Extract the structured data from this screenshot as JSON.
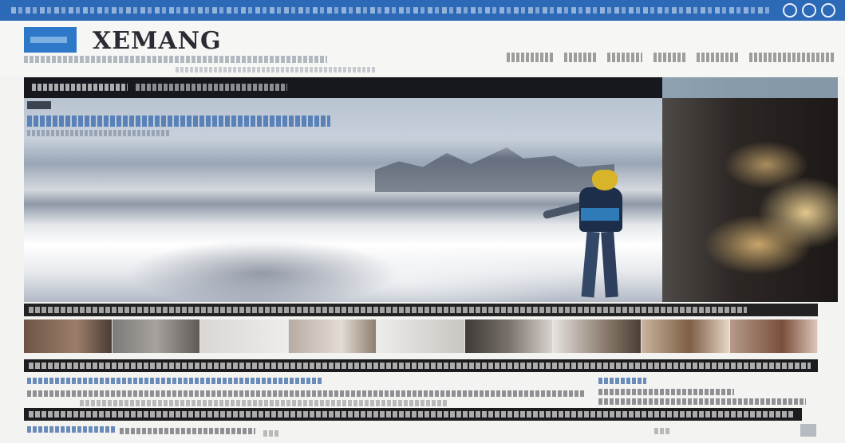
{
  "brand": {
    "name": "XEMANG",
    "logo_color": "#2d78c8"
  },
  "topbar": {
    "color": "#2c6ab8",
    "icons": [
      "search-icon",
      "user-icon",
      "menu-icon"
    ]
  },
  "nav": {
    "items": [
      "",
      "",
      "",
      "",
      "",
      "",
      ""
    ]
  },
  "colors": {
    "dark_strip": "#1c1c1f",
    "accent_blue": "#2f5fa3",
    "page_bg": "#f3f3f1"
  },
  "hero": {
    "icons": []
  }
}
